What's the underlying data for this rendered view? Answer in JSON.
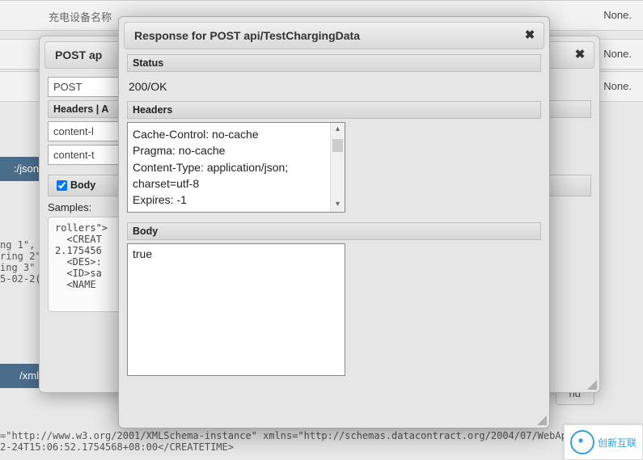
{
  "background": {
    "row1_left": "充电设备名称",
    "none": "None.",
    "tab_json": ":/json",
    "tab_xml": "/xml",
    "code_top": "ng 1\",\nring 2\",\ning 3\"\n5-02-2(",
    "code_bottom": "=\"http://www.w3.org/2001/XMLSchema-instance\" xmlns=\"http://schemas.datacontract.org/2004/07/WebApi\">\n2-24T15:06:52.1754568+08:00</CREATETIME>",
    "send_button": "nd"
  },
  "dialog_back": {
    "title": "POST ap",
    "method": "POST",
    "headers_label": "Headers | A",
    "field1": "content-l",
    "field2": "content-t",
    "body_label": "Body",
    "samples_label": "Samples:",
    "sample_text": "rollers\">\n  <CREAT\n2.175456\n  <DES>:\n  <ID>sa\n  <NAME"
  },
  "dialog_front": {
    "title": "Response for POST api/TestChargingData",
    "status_label": "Status",
    "status_text": "200/OK",
    "headers_label": "Headers",
    "headers_text": "Cache-Control: no-cache\nPragma: no-cache\nContent-Type: application/json;\ncharset=utf-8\nExpires: -1",
    "body_label": "Body",
    "body_text": "true"
  },
  "watermark": "创新互联"
}
